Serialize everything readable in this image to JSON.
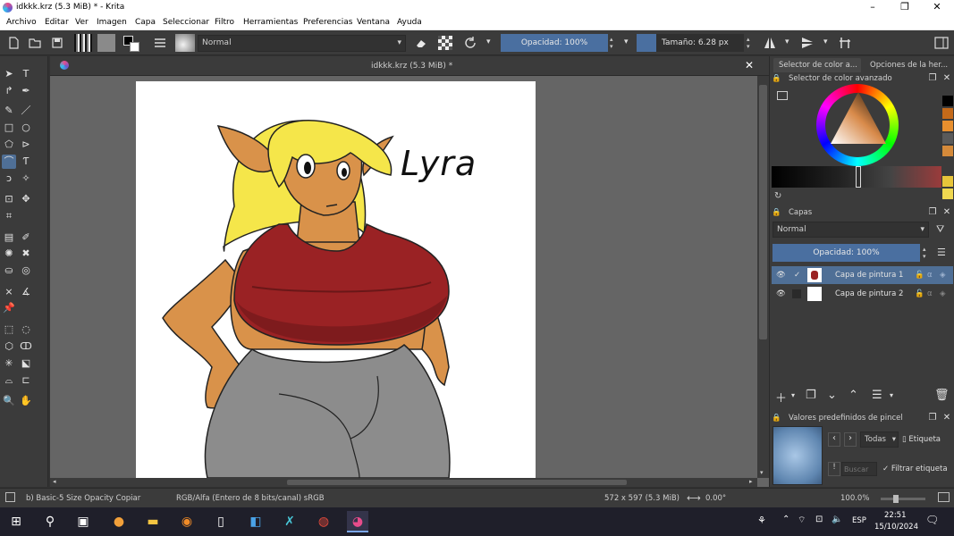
{
  "window": {
    "title": "idkkk.krz (5.3 MiB) * - Krita",
    "minimize": "–",
    "maximize": "❐",
    "close": "✕"
  },
  "menu": [
    "Archivo",
    "Editar",
    "Ver",
    "Imagen",
    "Capa",
    "Seleccionar",
    "Filtro",
    "Herramientas",
    "Preferencias",
    "Ventana",
    "Ayuda"
  ],
  "toolbar": {
    "blend_mode": "Normal",
    "opacity": "Opacidad: 100%",
    "size": "Tamaño: 6.28 px"
  },
  "document_tab": {
    "title": "idkkk.krz (5.3 MiB) *",
    "close": "✕"
  },
  "canvas": {
    "drawn_text": "Lyra"
  },
  "dock": {
    "tabs": [
      "Selector de color a...",
      "Opciones de la her..."
    ],
    "color_selector_title": "Selector de color avanzado",
    "swatches": [
      "#000000",
      "#c46a1a",
      "#e88f2e",
      "#d58a3a",
      "#b06020",
      "#e8c53a",
      "#f0d850"
    ],
    "layers": {
      "title": "Capas",
      "blend_mode": "Normal",
      "opacity": "Opacidad:  100%",
      "items": [
        {
          "name": "Capa de pintura 1",
          "selected": true
        },
        {
          "name": "Capa de pintura 2",
          "selected": false
        }
      ]
    },
    "brush_presets": {
      "title": "Valores predefinidos de pincel",
      "filter": "Todas",
      "tag": "Etiqueta",
      "search_placeholder": "Buscar",
      "filter_tag": "Filtrar etiqueta"
    }
  },
  "status": {
    "brush": "b) Basic-5 Size Opacity Copiar",
    "color_space": "RGB/Alfa (Entero de 8 bits/canal)  sRGB",
    "dimensions": "572 x 597 (5.3 MiB)",
    "rotation": "0.00°",
    "zoom": "100.0%"
  },
  "taskbar": {
    "language": "ESP",
    "time": "22:51",
    "date": "15/10/2024"
  }
}
